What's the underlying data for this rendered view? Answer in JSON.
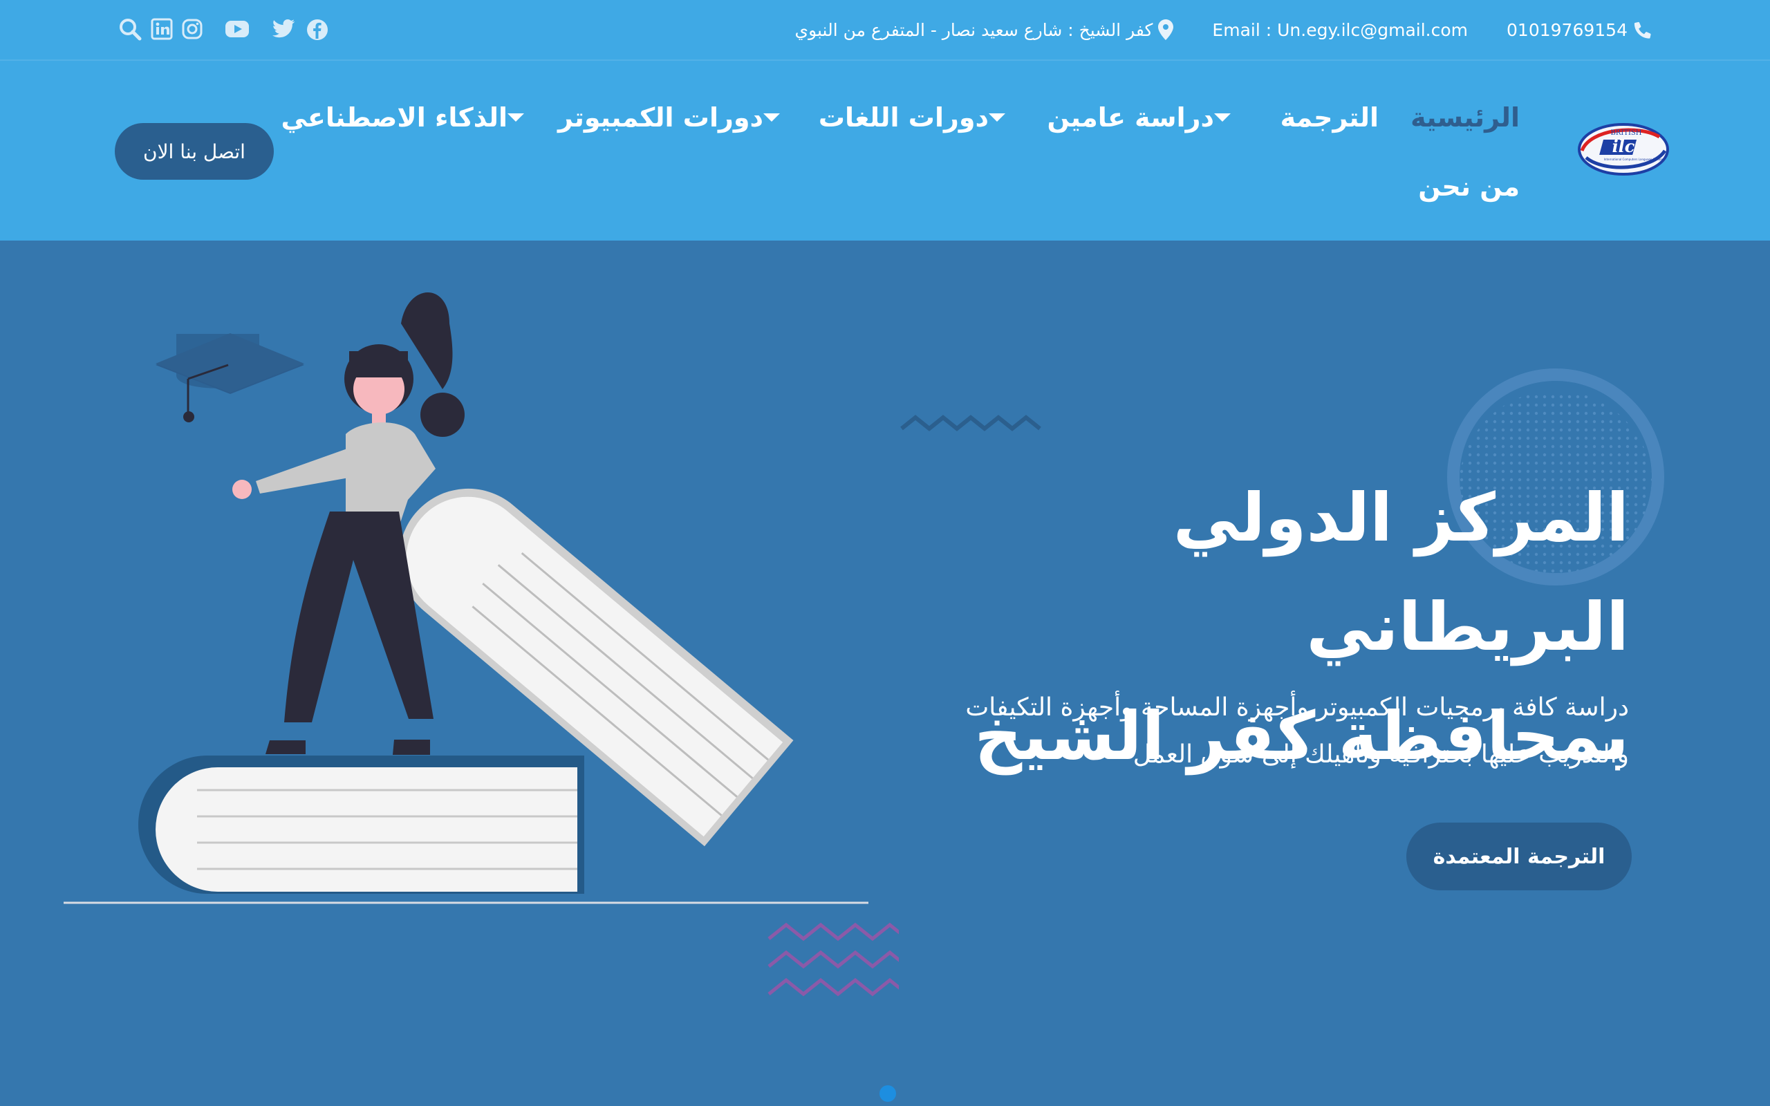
{
  "topbar": {
    "phone": "01019769154",
    "email": "Email : Un.egy.ilc@gmail.com",
    "address": "كفر الشيخ : شارع سعيد نصار - المتفرع من النبوي",
    "social_icons": [
      "facebook-icon",
      "twitter-icon",
      "youtube-icon",
      "instagram-icon",
      "linkedin-icon",
      "search-icon"
    ]
  },
  "logo": {
    "text_top": "BRITISH",
    "text_mark": "ilc",
    "text_bottom": "International Computers Language Center"
  },
  "nav": {
    "home": "الرئيسية",
    "translation": "الترجمة",
    "army_study": "دراسة عامين",
    "languages": "دورات اللغات",
    "computer": "دورات الكمبيوتر",
    "ai": "الذكاء الاصطناعي",
    "about": "من نحن"
  },
  "cta_top": "اتصل بنا الان",
  "hero": {
    "title_line1": "المركز الدولي البريطاني",
    "title_line2": "بمحافظة كفر الشيخ",
    "subtitle_line1": "دراسة كافة برمجيات الكمبيوتر وأجهزة المساحة وأجهزة التكيفات",
    "subtitle_line2": "والتدريب عليها بحترافية وتأهيلك إلى سوق العمل",
    "button": "الترجمة المعتمدة"
  },
  "colors": {
    "topbar": "#3fa9e5",
    "hero_bg": "#3577ae",
    "button": "#2a5f8f",
    "active_nav": "#2f5e8e",
    "slider_dot": "#1d8ee0"
  }
}
